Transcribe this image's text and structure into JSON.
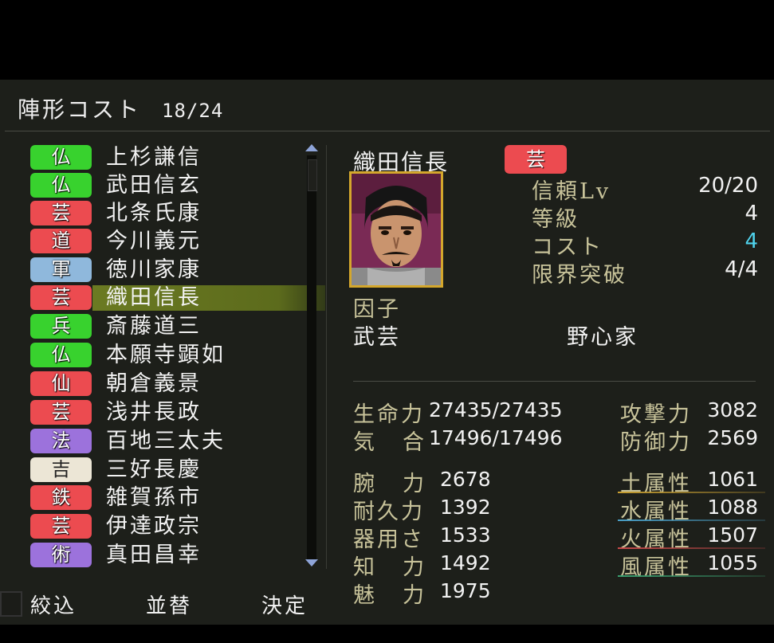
{
  "header": {
    "label": "陣形コスト",
    "value": "18/24"
  },
  "list": [
    {
      "badge": "仏",
      "color": "green",
      "name": "上杉謙信"
    },
    {
      "badge": "仏",
      "color": "green",
      "name": "武田信玄"
    },
    {
      "badge": "芸",
      "color": "red",
      "name": "北条氏康"
    },
    {
      "badge": "道",
      "color": "red",
      "name": "今川義元"
    },
    {
      "badge": "軍",
      "color": "blue",
      "name": "徳川家康"
    },
    {
      "badge": "芸",
      "color": "red",
      "name": "織田信長",
      "selected": true
    },
    {
      "badge": "兵",
      "color": "green",
      "name": "斎藤道三"
    },
    {
      "badge": "仏",
      "color": "green",
      "name": "本願寺顕如"
    },
    {
      "badge": "仙",
      "color": "red",
      "name": "朝倉義景"
    },
    {
      "badge": "芸",
      "color": "red",
      "name": "浅井長政"
    },
    {
      "badge": "法",
      "color": "purple",
      "name": "百地三太夫"
    },
    {
      "badge": "吉",
      "color": "cream",
      "name": "三好長慶"
    },
    {
      "badge": "鉄",
      "color": "red",
      "name": "雑賀孫市"
    },
    {
      "badge": "芸",
      "color": "red",
      "name": "伊達政宗"
    },
    {
      "badge": "術",
      "color": "purple",
      "name": "真田昌幸"
    }
  ],
  "bottom": {
    "filter": "絞込",
    "sort": "並替",
    "confirm": "決定"
  },
  "detail": {
    "name": "織田信長",
    "badge": "芸",
    "trust_label": "信頼Lv",
    "trust_value": "20/20",
    "rank_label": "等級",
    "rank_value": "4",
    "cost_label": "コスト",
    "cost_value": "4",
    "limit_label": "限界突破",
    "limit_value": "4/4",
    "factor_label": "因子",
    "factor1": "武芸",
    "factor2": "野心家",
    "hp_label": "生命力",
    "hp_value": "27435/27435",
    "ki_label1": "気",
    "ki_label2": "合",
    "ki_value": "17496/17496",
    "atk_label": "攻撃力",
    "atk_value": "3082",
    "def_label": "防御力",
    "def_value": "2569",
    "str_label1": "腕",
    "str_label2": "力",
    "str_value": "2678",
    "end_label": "耐久力",
    "end_value": "1392",
    "dex_label": "器用さ",
    "dex_value": "1533",
    "int_label1": "知",
    "int_label2": "力",
    "int_value": "1492",
    "cha_label1": "魅",
    "cha_label2": "力",
    "cha_value": "1975",
    "earth_label": "土属性",
    "earth_value": "1061",
    "water_label": "水属性",
    "water_value": "1088",
    "fire_label": "火属性",
    "fire_value": "1507",
    "wind_label": "風属性",
    "wind_value": "1055"
  },
  "colors": {
    "earth": "#c9a032",
    "water": "#4aa0c8",
    "fire": "#c84a4a",
    "wind": "#3aa070"
  }
}
